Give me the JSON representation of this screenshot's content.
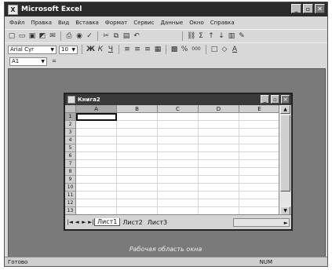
{
  "app": {
    "title": "Microsoft Excel",
    "logo_text": "X"
  },
  "window_buttons": {
    "minimize": "_",
    "restore": "▫",
    "close": "✕"
  },
  "menu": [
    "Файл",
    "Правка",
    "Вид",
    "Вставка",
    "Формат",
    "Сервис",
    "Данные",
    "Окно",
    "Справка"
  ],
  "toolbar1": {
    "icons": [
      "new-icon",
      "open-icon",
      "save-icon",
      "permission-icon",
      "email-icon",
      "print-icon",
      "preview-icon",
      "spelling-icon",
      "cut-icon",
      "copy-icon",
      "paste-icon",
      "undo-icon",
      "hyperlink-icon",
      "autosum-icon",
      "sort-asc-icon",
      "sort-desc-icon",
      "chart-icon",
      "drawing-icon"
    ],
    "glyphs": [
      "▢",
      "▭",
      "▣",
      "◩",
      "✉",
      "⎙",
      "◉",
      "✓",
      "✂",
      "⧉",
      "▤",
      "↶",
      "⛓",
      "Σ",
      "↑",
      "↓",
      "▥",
      "✎"
    ]
  },
  "toolbar2": {
    "font": "Arial Cyr",
    "size": "10",
    "format_glyphs": [
      "Ж",
      "К",
      "Ч",
      "≡",
      "≡",
      "≡",
      "▦",
      "▩",
      "%",
      "000",
      "□",
      "◇",
      "A"
    ],
    "format_names": [
      "bold-icon",
      "italic-icon",
      "underline-icon",
      "align-left-icon",
      "align-center-icon",
      "align-right-icon",
      "merge-icon",
      "currency-icon",
      "percent-icon",
      "thousands-icon",
      "borders-icon",
      "fill-color-icon",
      "font-color-icon"
    ]
  },
  "formula_bar": {
    "namebox": "A1",
    "fx": "="
  },
  "workbook": {
    "title": "Книга2",
    "columns": [
      "A",
      "B",
      "C",
      "D",
      "E"
    ],
    "rows": [
      "1",
      "2",
      "3",
      "4",
      "5",
      "6",
      "7",
      "8",
      "9",
      "10",
      "11",
      "12",
      "13"
    ],
    "selected_cell": "A1",
    "sheet_tabs": [
      "Лист1",
      "Лист2",
      "Лист3"
    ],
    "tab_nav": [
      "|◄",
      "◄",
      "►",
      "►|"
    ]
  },
  "caption": "Рабочая область окна",
  "status": {
    "left": "Готово",
    "indicator": "NUM"
  }
}
